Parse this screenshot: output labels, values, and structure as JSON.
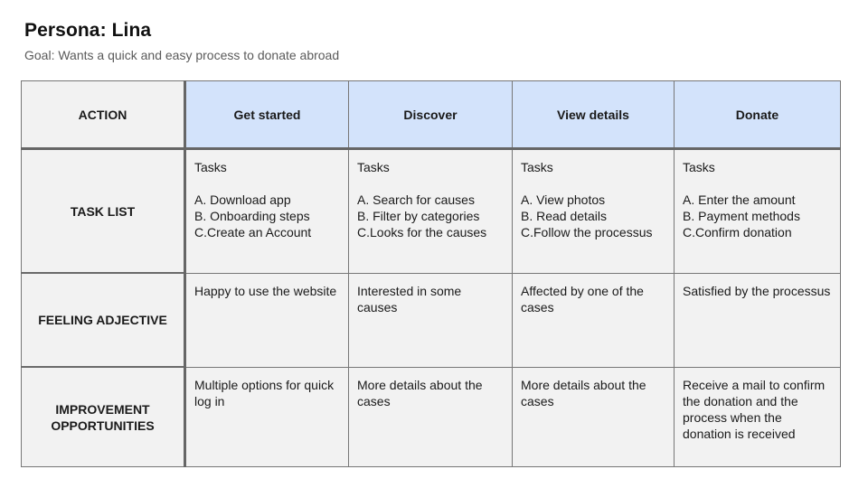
{
  "header": {
    "title": "Persona: Lina",
    "goal": "Goal: Wants a quick and easy process to donate abroad"
  },
  "table": {
    "corner_label": "ACTION",
    "stages": [
      "Get started",
      "Discover",
      "View details",
      "Donate"
    ],
    "rows": {
      "task_list": {
        "label": "TASK LIST",
        "cells": [
          {
            "heading": "Tasks",
            "items": [
              "A. Download app",
              "B. Onboarding steps",
              "C.Create an Account"
            ]
          },
          {
            "heading": "Tasks",
            "items": [
              "A. Search for causes",
              "B. Filter by categories",
              "C.Looks for the causes"
            ]
          },
          {
            "heading": "Tasks",
            "items": [
              "A. View photos",
              "B. Read details",
              "C.Follow the processus"
            ]
          },
          {
            "heading": "Tasks",
            "items": [
              "A. Enter the amount",
              "B. Payment methods",
              "C.Confirm donation"
            ]
          }
        ]
      },
      "feeling": {
        "label": "FEELING ADJECTIVE",
        "cells": [
          "Happy to use the website",
          "Interested in some causes",
          "Affected by one of the cases",
          "Satisfied by the processus"
        ]
      },
      "improvement": {
        "label_line1": "IMPROVEMENT",
        "label_line2": "OPPORTUNITIES",
        "cells": [
          "Multiple options for quick log in",
          "More details about the cases",
          "More details about the cases",
          "Receive a mail to confirm the donation and the process when the donation is received"
        ]
      }
    }
  },
  "colors": {
    "stage_header_bg": "#d3e3fb",
    "cell_bg": "#f2f2f2",
    "border": "#666666"
  }
}
